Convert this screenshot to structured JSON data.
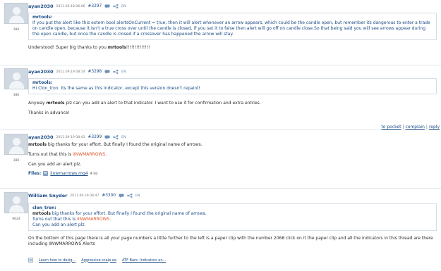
{
  "posts": [
    {
      "author": "ayan2030",
      "date": "2011.09.18 06:06",
      "number": "#3297",
      "lang": "EN",
      "rep": "380",
      "quote_author": "mrtools:",
      "quote_text": "If you put the alert like this extern bool alertsOnCurrent = true; then it will alert whenever an arrow appears, which could be the candle open, but remember its dangerous to enter a trade on candle open, because it isn't a true cross over until the candle is closed, if you set it to false then alert will go off on candle close.So that being said you will see arrows appear during the open candle, but once the candle is closed if a crossover has happened the arrow will stay.",
      "body_pre": "Understood! Super big thanks to you ",
      "body_bold": "mrtools",
      "body_post": "!!!!!!!!!!!!!!"
    },
    {
      "author": "ayan2030",
      "date": "2011.09.19 08:14",
      "number": "#3298",
      "lang": "EN",
      "rep": "380",
      "quote_author": "mrtools:",
      "quote_text": "Hi Clon_tron. Its the same as this indicator, except this version doesn't repaint!",
      "body_pre": "Anyway ",
      "body_bold": "mrtools",
      "body_post": " plz can you add an alert to that indicator. I want to use it for confirmation and extra entries.",
      "body2": "Thanks in advance!",
      "links": {
        "pocket": "to pocket",
        "complain": "complain",
        "reply": "reply",
        "sep": "|"
      }
    },
    {
      "author": "ayan2030",
      "date": "2011.09.19 08:41",
      "number": "#3299",
      "lang": "EN",
      "rep": "380",
      "line1_bold": "mrtools",
      "line1_rest": " big thanks for your effort. But finally I found the original name of arrows.",
      "line2_pre": "Turns out that this is ",
      "line2_hl": "IINWMARROWS",
      "line2_post": ".",
      "line3": "Can you add an alert plz.",
      "files_label": "Files:",
      "file_name": "iinwmarrows.mq4",
      "file_size": "4 kb"
    },
    {
      "author": "William Snyder",
      "date": "2011.09.19 08:47",
      "number": "#3300",
      "lang": "EN",
      "rep": "9624",
      "quote_author": "clon_tron:",
      "q1_bold": "mrtools",
      "q1_rest": " big thanks for your effort. But finally I found the original name of arrows.",
      "q2_pre": "Turns out that this is ",
      "q2_hl": "IINWMARROWS",
      "q2_post": ".",
      "q3": "Can you add an alert plz.",
      "body": "On the bottom of this page there is all your page numbers a little further to the left is a paper clip with the number 2068 click on it the paper clip and all the indicators in this thread are there including IINWMARROWS Alerts"
    }
  ],
  "related": [
    "Learn how to desig...",
    "Aggressive scalp ea",
    "ATF Bars: Indicators an..."
  ]
}
